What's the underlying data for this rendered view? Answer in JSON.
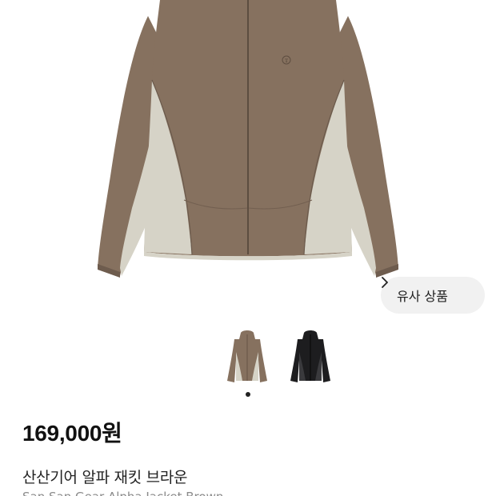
{
  "product": {
    "price": "169,000원",
    "name": "산산기어 알파 재킷 브라운",
    "english_name": "San San Gear Alpha Jacket Brown"
  },
  "similar_button": {
    "label": "유사 상품",
    "icon": "chevron-right-icon"
  },
  "gallery": {
    "active_index": 1,
    "total": 1,
    "thumbnails": [
      {
        "color": "brown",
        "icon": "jacket-brown-thumbnail"
      },
      {
        "color": "black",
        "icon": "jacket-black-thumbnail"
      }
    ]
  },
  "colors": {
    "jacket_brown": "#86715f",
    "jacket_panel": "#d6d3c7",
    "jacket_black": "#1d1d1f",
    "button_bg": "#f1f1f1",
    "price_text": "#111111"
  }
}
